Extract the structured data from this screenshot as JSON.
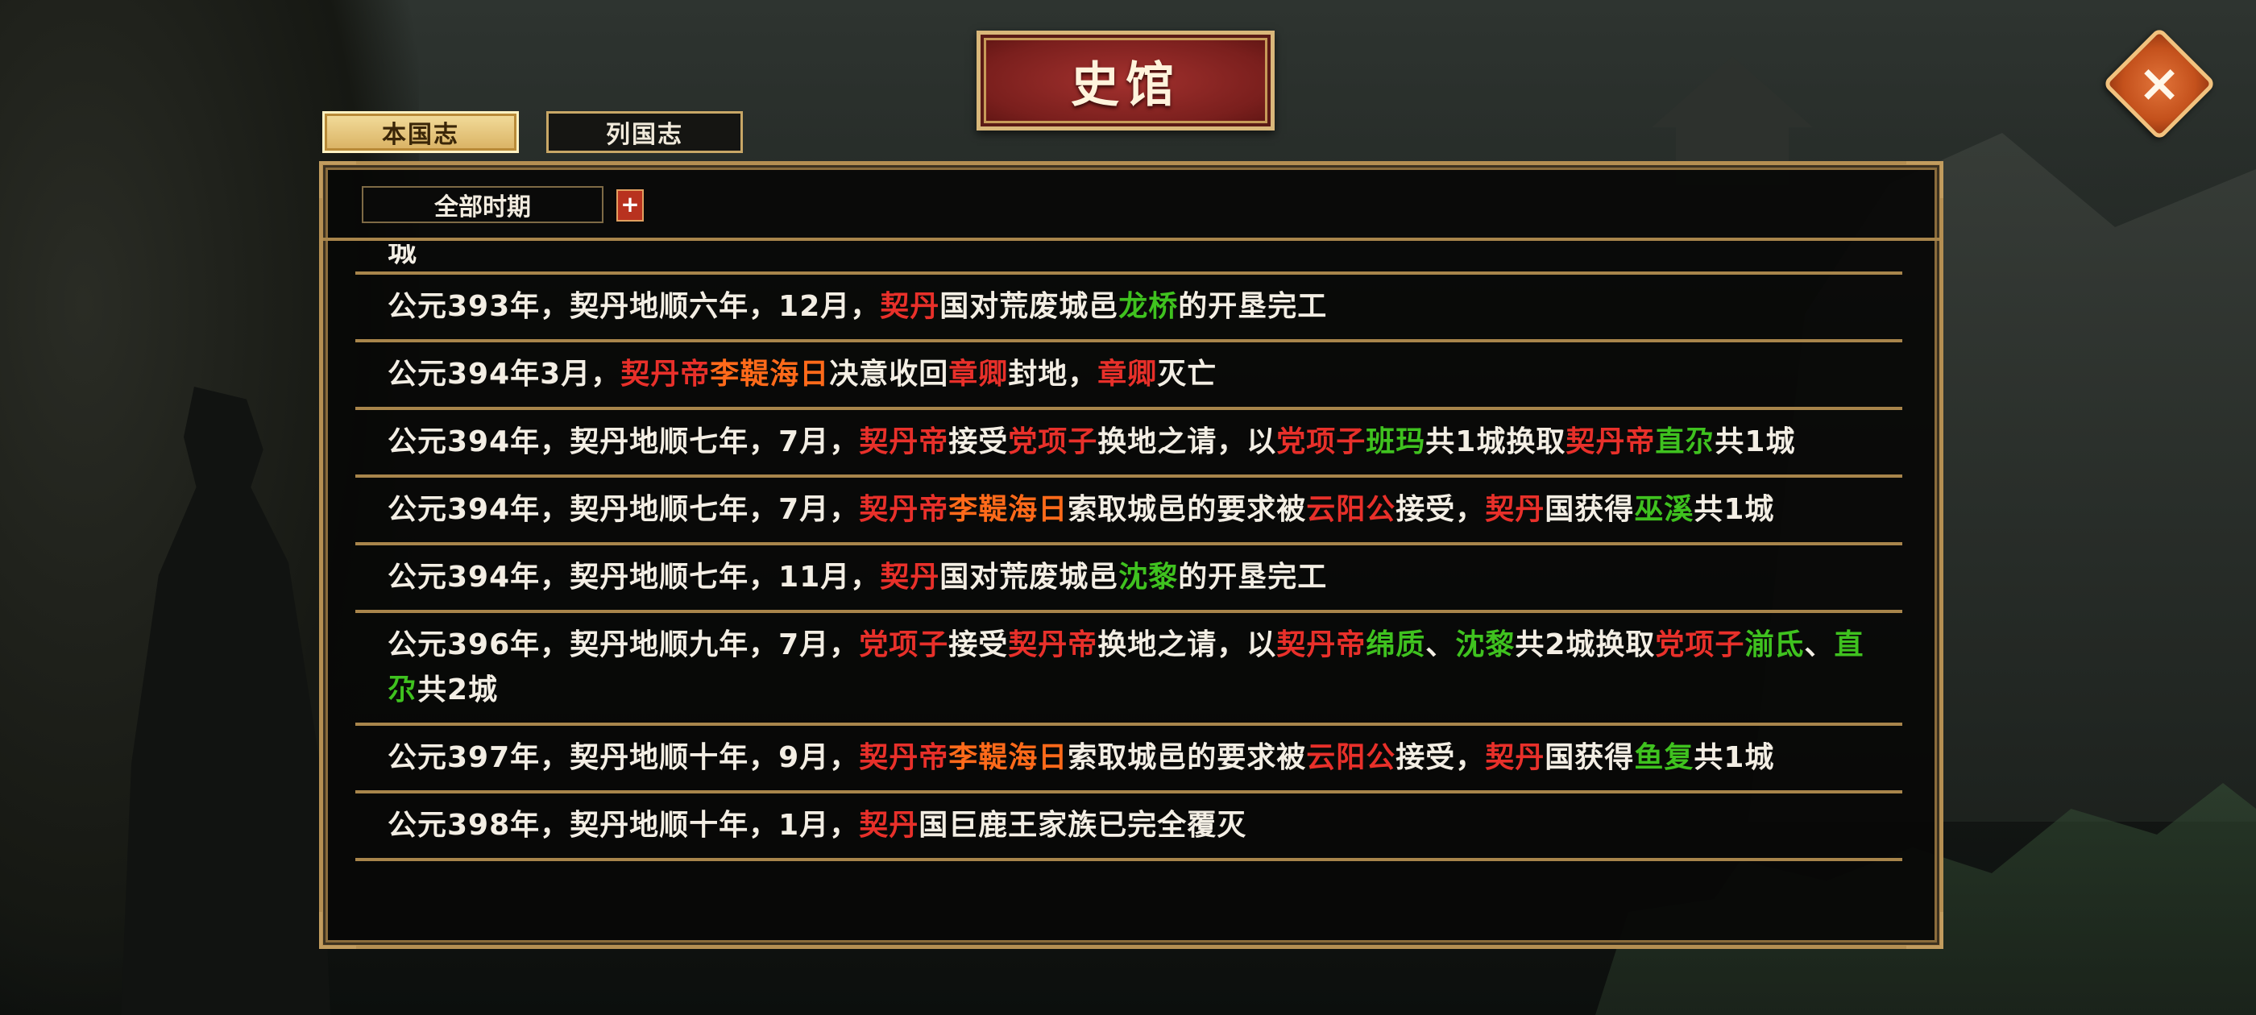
{
  "title": "史馆",
  "tabs": [
    {
      "label": "本国志",
      "active": true
    },
    {
      "label": "列国志",
      "active": false
    }
  ],
  "filter": {
    "period": "全部时期",
    "plus": "+"
  },
  "close_icon": "close-x-icon",
  "colors": {
    "red": "#e8302a",
    "green": "#3fc21f",
    "orange": "#ff6a1a",
    "text": "#f3eee4",
    "gold": "#b58f52"
  },
  "entries": [
    {
      "segments": [
        {
          "t": "城",
          "c": "plain"
        }
      ],
      "cut": true
    },
    {
      "segments": [
        {
          "t": "公元393年，契丹地顺六年，12月，",
          "c": "plain"
        },
        {
          "t": "契丹",
          "c": "red"
        },
        {
          "t": "国对荒废城邑",
          "c": "plain"
        },
        {
          "t": "龙桥",
          "c": "green"
        },
        {
          "t": "的开垦完工",
          "c": "plain"
        }
      ]
    },
    {
      "segments": [
        {
          "t": "公元394年3月，",
          "c": "plain"
        },
        {
          "t": "契丹帝",
          "c": "red"
        },
        {
          "t": "李鞮海日",
          "c": "orange"
        },
        {
          "t": "决意收回",
          "c": "plain"
        },
        {
          "t": "章卿",
          "c": "red"
        },
        {
          "t": "封地，",
          "c": "plain"
        },
        {
          "t": "章卿",
          "c": "red"
        },
        {
          "t": "灭亡",
          "c": "plain"
        }
      ]
    },
    {
      "segments": [
        {
          "t": "公元394年，契丹地顺七年，7月，",
          "c": "plain"
        },
        {
          "t": "契丹帝",
          "c": "red"
        },
        {
          "t": "接受",
          "c": "plain"
        },
        {
          "t": "党项子",
          "c": "red"
        },
        {
          "t": "换地之请，以",
          "c": "plain"
        },
        {
          "t": "党项子",
          "c": "red"
        },
        {
          "t": "班玛",
          "c": "green"
        },
        {
          "t": "共1城换取",
          "c": "plain"
        },
        {
          "t": "契丹帝",
          "c": "red"
        },
        {
          "t": "直尕",
          "c": "green"
        },
        {
          "t": "共1城",
          "c": "plain"
        }
      ]
    },
    {
      "segments": [
        {
          "t": "公元394年，契丹地顺七年，7月，",
          "c": "plain"
        },
        {
          "t": "契丹帝",
          "c": "red"
        },
        {
          "t": "李鞮海日",
          "c": "orange"
        },
        {
          "t": "索取城邑的要求被",
          "c": "plain"
        },
        {
          "t": "云阳公",
          "c": "red"
        },
        {
          "t": "接受，",
          "c": "plain"
        },
        {
          "t": "契丹",
          "c": "red"
        },
        {
          "t": "国获得",
          "c": "plain"
        },
        {
          "t": "巫溪",
          "c": "green"
        },
        {
          "t": "共1城",
          "c": "plain"
        }
      ]
    },
    {
      "segments": [
        {
          "t": "公元394年，契丹地顺七年，11月，",
          "c": "plain"
        },
        {
          "t": "契丹",
          "c": "red"
        },
        {
          "t": "国对荒废城邑",
          "c": "plain"
        },
        {
          "t": "沈黎",
          "c": "green"
        },
        {
          "t": "的开垦完工",
          "c": "plain"
        }
      ]
    },
    {
      "segments": [
        {
          "t": "公元396年，契丹地顺九年，7月，",
          "c": "plain"
        },
        {
          "t": "党项子",
          "c": "red"
        },
        {
          "t": "接受",
          "c": "plain"
        },
        {
          "t": "契丹帝",
          "c": "red"
        },
        {
          "t": "换地之请，以",
          "c": "plain"
        },
        {
          "t": "契丹帝",
          "c": "red"
        },
        {
          "t": "绵质",
          "c": "green"
        },
        {
          "t": "、",
          "c": "plain"
        },
        {
          "t": "沈黎",
          "c": "green"
        },
        {
          "t": "共2城换取",
          "c": "plain"
        },
        {
          "t": "党项子",
          "c": "red"
        },
        {
          "t": "湔氐",
          "c": "green"
        },
        {
          "t": "、",
          "c": "plain"
        },
        {
          "t": "直尕",
          "c": "green"
        },
        {
          "t": "共2城",
          "c": "plain"
        }
      ]
    },
    {
      "segments": [
        {
          "t": "公元397年，契丹地顺十年，9月，",
          "c": "plain"
        },
        {
          "t": "契丹帝",
          "c": "red"
        },
        {
          "t": "李鞮海日",
          "c": "orange"
        },
        {
          "t": "索取城邑的要求被",
          "c": "plain"
        },
        {
          "t": "云阳公",
          "c": "red"
        },
        {
          "t": "接受，",
          "c": "plain"
        },
        {
          "t": "契丹",
          "c": "red"
        },
        {
          "t": "国获得",
          "c": "plain"
        },
        {
          "t": "鱼复",
          "c": "green"
        },
        {
          "t": "共1城",
          "c": "plain"
        }
      ]
    },
    {
      "segments": [
        {
          "t": "公元398年，契丹地顺十年，1月，",
          "c": "plain"
        },
        {
          "t": "契丹",
          "c": "red"
        },
        {
          "t": "国巨鹿王家族已完全覆灭",
          "c": "plain"
        }
      ]
    }
  ]
}
